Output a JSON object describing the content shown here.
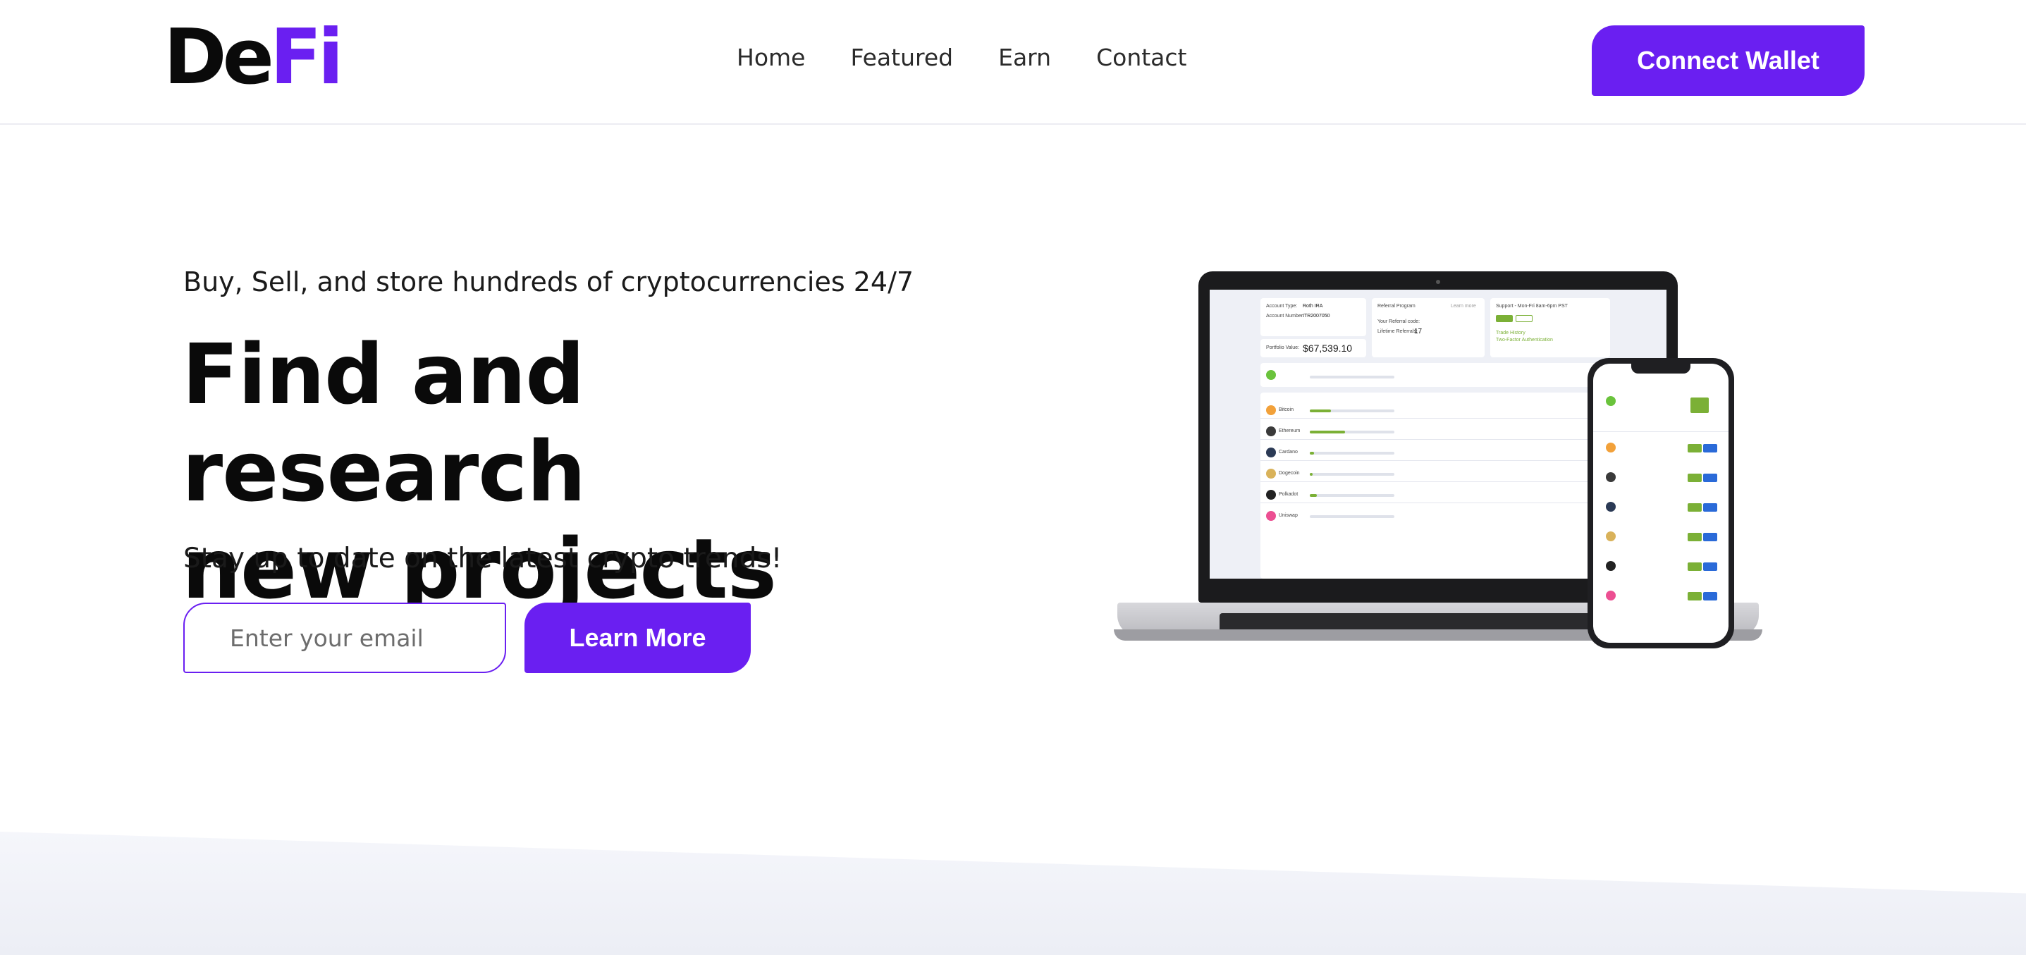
{
  "header": {
    "logo_part1": "De",
    "logo_part2": "Fi",
    "nav": [
      "Home",
      "Featured",
      "Earn",
      "Contact"
    ],
    "connect_label": "Connect Wallet"
  },
  "hero": {
    "tagline": "Buy, Sell, and store hundreds of cryptocurrencies 24/7",
    "headline_line1": "Find and research",
    "headline_line2": "new projects",
    "subhead": "Stay up to date on the latest crypto trends!",
    "email_placeholder": "Enter your email",
    "learn_label": "Learn More"
  },
  "mockup": {
    "account_type_label": "Account Type:",
    "account_type_value": "Roth IRA",
    "account_number_label": "Account Number:",
    "account_number_value": "ITR2007050",
    "portfolio_label": "Portfolio Value:",
    "portfolio_value": "$67,539.10",
    "referral_title": "Referral Program",
    "learn_more": "Learn more",
    "referral_code_label": "Your Referral code:",
    "referrals_label": "Lifetime Referrals:",
    "referrals_value": "17",
    "support_title": "Support - Mon-Fri 8am-6pm PST",
    "trade_history": "Trade History",
    "two_factor": "Two-Factor Authentication",
    "coins": [
      "Bitcoin",
      "Ethereum",
      "Cardano",
      "Dogecoin",
      "Polkadot",
      "Uniswap"
    ],
    "colors": {
      "brand": "#6a1ff1",
      "buy": "#7bb036",
      "sell": "#2a6ad8"
    }
  }
}
